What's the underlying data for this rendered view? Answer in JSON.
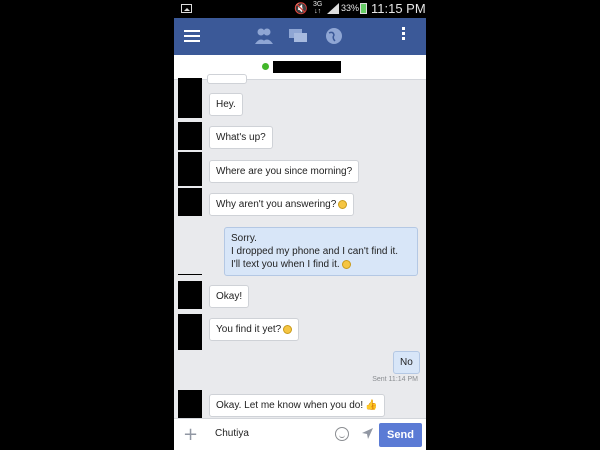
{
  "status_bar": {
    "network": "3G",
    "battery": "33%",
    "time": "11:15 PM"
  },
  "nav": {
    "icons": [
      "menu-icon",
      "friends-icon",
      "messages-icon",
      "globe-icon",
      "overflow-menu-icon"
    ]
  },
  "chat_header": {
    "online_color": "#42b72a"
  },
  "messages": [
    {
      "dir": "in",
      "text": "Hey."
    },
    {
      "dir": "in",
      "text": "What's up?"
    },
    {
      "dir": "in",
      "text": "Where are you since morning?"
    },
    {
      "dir": "in",
      "text": "Why aren't you answering?",
      "emoji": "sad-emoji-icon"
    },
    {
      "dir": "out",
      "lines": [
        "Sorry.",
        "I dropped my phone and I can't find it.",
        "I'll text you when I find it."
      ],
      "emoji": "smile-emoji-icon"
    },
    {
      "dir": "in",
      "text": "Okay!"
    },
    {
      "dir": "in",
      "text": "You find it yet?",
      "emoji": "grin-emoji-icon"
    },
    {
      "dir": "out",
      "text": "No"
    },
    {
      "dir": "in",
      "text": "Okay. Let me know when you do!",
      "emoji": "thumbs-up-icon"
    }
  ],
  "sent_label": "Sent 11:14 PM",
  "composer": {
    "input_value": "Chutiya",
    "send_label": "Send"
  },
  "colors": {
    "nav_bg": "#3b5998",
    "outgoing_bubble": "#d8e6f8",
    "send_button": "#5b7bd5"
  }
}
